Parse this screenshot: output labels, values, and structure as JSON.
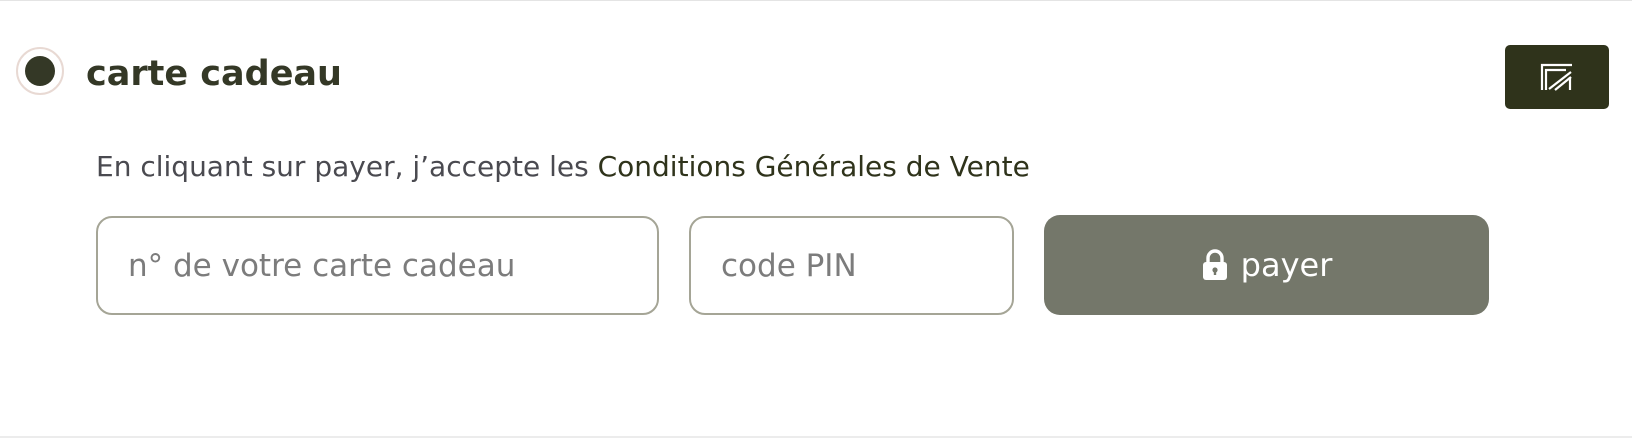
{
  "payment_option": {
    "title": "carte cadeau",
    "selected": true
  },
  "brand_badge": {
    "icon": "brand-logo-icon",
    "background": "#2f331b"
  },
  "terms": {
    "prefix": "En cliquant sur payer, j’accepte les ",
    "link_text": "Conditions Générales de Vente"
  },
  "form": {
    "card_number": {
      "placeholder": "n° de votre carte cadeau",
      "value": ""
    },
    "pin": {
      "placeholder": "code PIN",
      "value": ""
    },
    "pay_button": {
      "label": "payer",
      "icon": "lock-icon",
      "background": "#74776a"
    }
  },
  "colors": {
    "primary_dark": "#343826",
    "text_muted": "#4a4a50",
    "input_border": "#a5a596"
  }
}
